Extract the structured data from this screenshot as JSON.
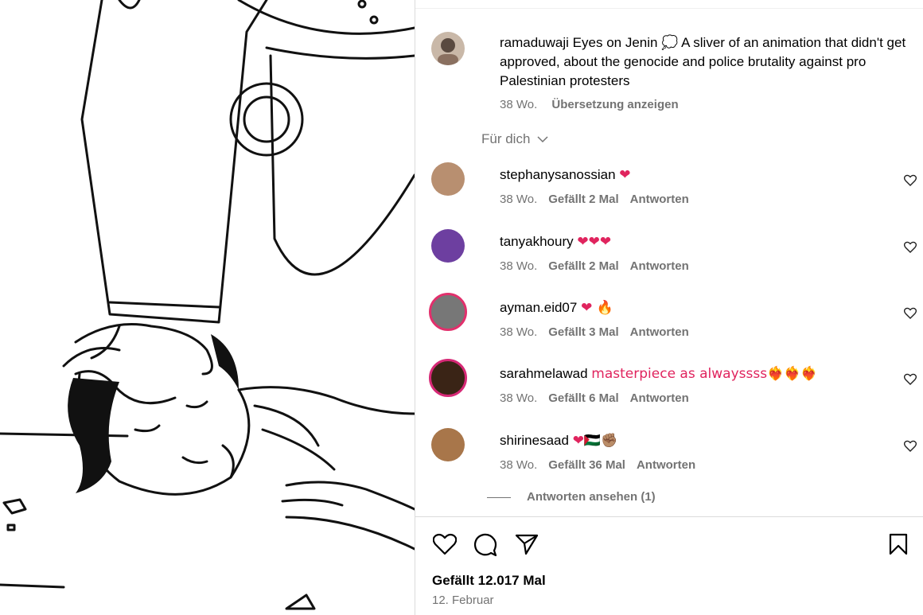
{
  "post": {
    "author": "ramaduwaji",
    "caption": "Eyes on Jenin 💭 A sliver of an animation that didn't get approved, about the genocide and police brutality against pro Palestinian protesters",
    "time": "38 Wo.",
    "translate_label": "Übersetzung anzeigen",
    "likes": "Gefällt 12.017 Mal",
    "date": "12. Februar"
  },
  "filter_label": "Für dich",
  "comments": [
    {
      "user": "stephanysanossian",
      "text": "❤",
      "time": "38 Wo.",
      "likes": "Gefällt 2 Mal",
      "reply": "Antworten"
    },
    {
      "user": "tanyakhoury",
      "text": "❤❤❤",
      "time": "38 Wo.",
      "likes": "Gefällt 2 Mal",
      "reply": "Antworten"
    },
    {
      "user": "ayman.eid07",
      "text": "❤ 🔥",
      "time": "38 Wo.",
      "likes": "Gefällt 3 Mal",
      "reply": "Antworten"
    },
    {
      "user": "sarahmelawad",
      "text": "masterpiece as alwayssss❤‍🔥❤‍🔥❤‍🔥",
      "time": "38 Wo.",
      "likes": "Gefällt 6 Mal",
      "reply": "Antworten"
    },
    {
      "user": "shirinesaad",
      "text": "❤🇵🇸✊🏽",
      "time": "38 Wo.",
      "likes": "Gefällt 36 Mal",
      "reply": "Antworten"
    }
  ],
  "view_replies": "Antworten ansehen (1)",
  "icons": [
    "heart-icon",
    "comment-icon",
    "share-icon",
    "bookmark-icon"
  ]
}
